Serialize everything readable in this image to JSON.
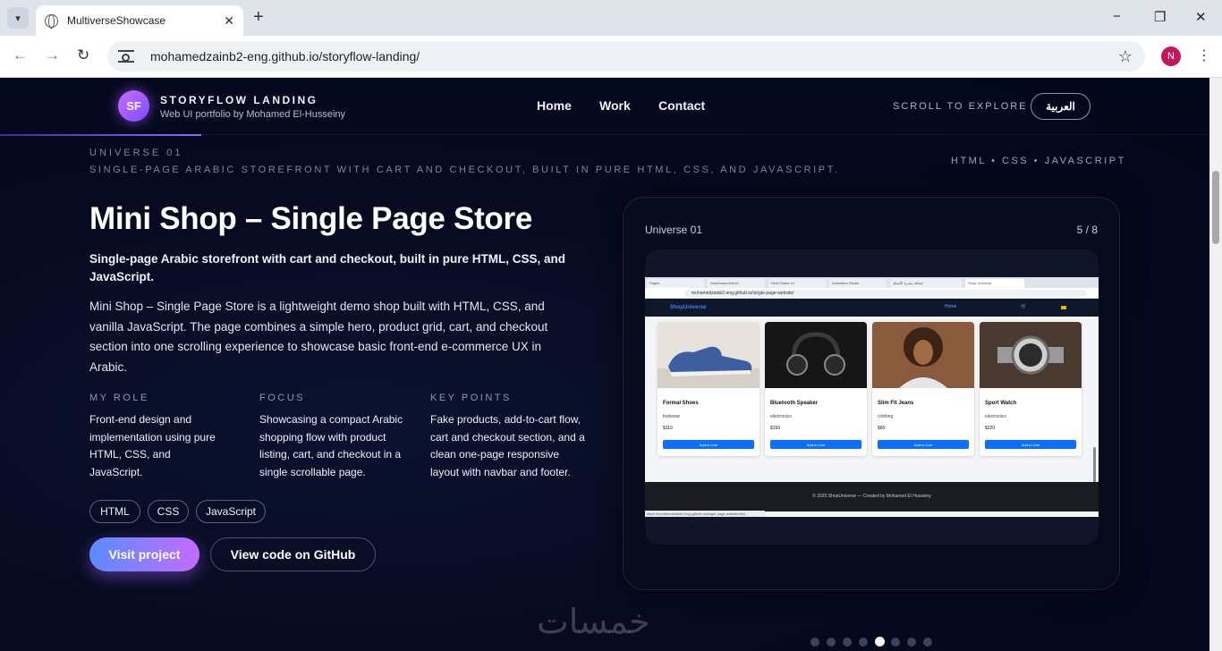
{
  "browser": {
    "tab_title": "MultiverseShowcase",
    "url": "mohamedzainb2-eng.github.io/storyflow-landing/",
    "profile_initial": "N",
    "window_controls": [
      "−",
      "❐",
      "✕"
    ]
  },
  "header": {
    "logo_initials": "SF",
    "brand_title": "STORYFLOW LANDING",
    "brand_subtitle": "Web UI portfolio by Mohamed El-Husseiny",
    "nav": [
      "Home",
      "Work",
      "Contact"
    ],
    "scroll_hint": "SCROLL TO EXPLORE",
    "lang_button": "العربية"
  },
  "universe": {
    "label": "UNIVERSE 01",
    "tagline": "SINGLE-PAGE ARABIC STOREFRONT WITH CART AND CHECKOUT, BUILT IN PURE HTML, CSS, AND JAVASCRIPT.",
    "tech_line": "HTML • CSS • JAVASCRIPT"
  },
  "project": {
    "title": "Mini Shop – Single Page Store",
    "lead": "Single-page Arabic storefront with cart and checkout, built in pure HTML, CSS, and JavaScript.",
    "description": "Mini Shop – Single Page Store is a lightweight demo shop built with HTML, CSS, and vanilla JavaScript. The page combines a simple hero, product grid, cart, and checkout section into one scrolling experience to showcase basic front-end e-commerce UX in Arabic.",
    "info": [
      {
        "heading": "MY ROLE",
        "text": "Front-end design and implementation using pure HTML, CSS, and JavaScript."
      },
      {
        "heading": "FOCUS",
        "text": "Showcasing a compact Arabic shopping flow with product listing, cart, and checkout in a single scrollable page."
      },
      {
        "heading": "KEY POINTS",
        "text": "Fake products, add-to-cart flow, cart and checkout section, and a clean one-page responsive layout with navbar and footer."
      }
    ],
    "tags": [
      "HTML",
      "CSS",
      "JavaScript"
    ],
    "visit_button": "Visit project",
    "github_button": "View code on GitHub"
  },
  "showcase": {
    "universe": "Universe 01",
    "counter": "5 / 8",
    "dot_count": 8,
    "active_dot": 5,
    "screenshot": {
      "tabs": [
        "Pages",
        "Dashboard Admin",
        "Real Estate UI",
        "Animation Studio",
        "إضافة مقترح الأسئلة",
        "Shop Universe"
      ],
      "url": "mohamedzainb2-eng.github.io/single-page-website/",
      "brand": "ShopUniverse",
      "nav_home": "Home",
      "cart_icon": "🛒",
      "products": [
        {
          "name": "Formal Shoes",
          "category": "footwear",
          "price": "$110",
          "button": "Add to Cart"
        },
        {
          "name": "Bluetooth Speaker",
          "category": "electronics",
          "price": "$150",
          "button": "Add to Cart"
        },
        {
          "name": "Slim Fit Jeans",
          "category": "clothing",
          "price": "$60",
          "button": "Add to Cart"
        },
        {
          "name": "Sport Watch",
          "category": "electronics",
          "price": "$220",
          "button": "Add to Cart"
        }
      ],
      "footer": "© 2025 ShopUniverse — Created by Mohamed El Husseiny",
      "status_url": "https://mohamedzainb2-eng.github.io/single-page-website/#ho"
    }
  },
  "watermark": "خمسات",
  "colors": {
    "accent_start": "#5b8cff",
    "accent_end": "#c46bff",
    "page_bg": "#05071a",
    "mini_button": "#0d6efd"
  }
}
